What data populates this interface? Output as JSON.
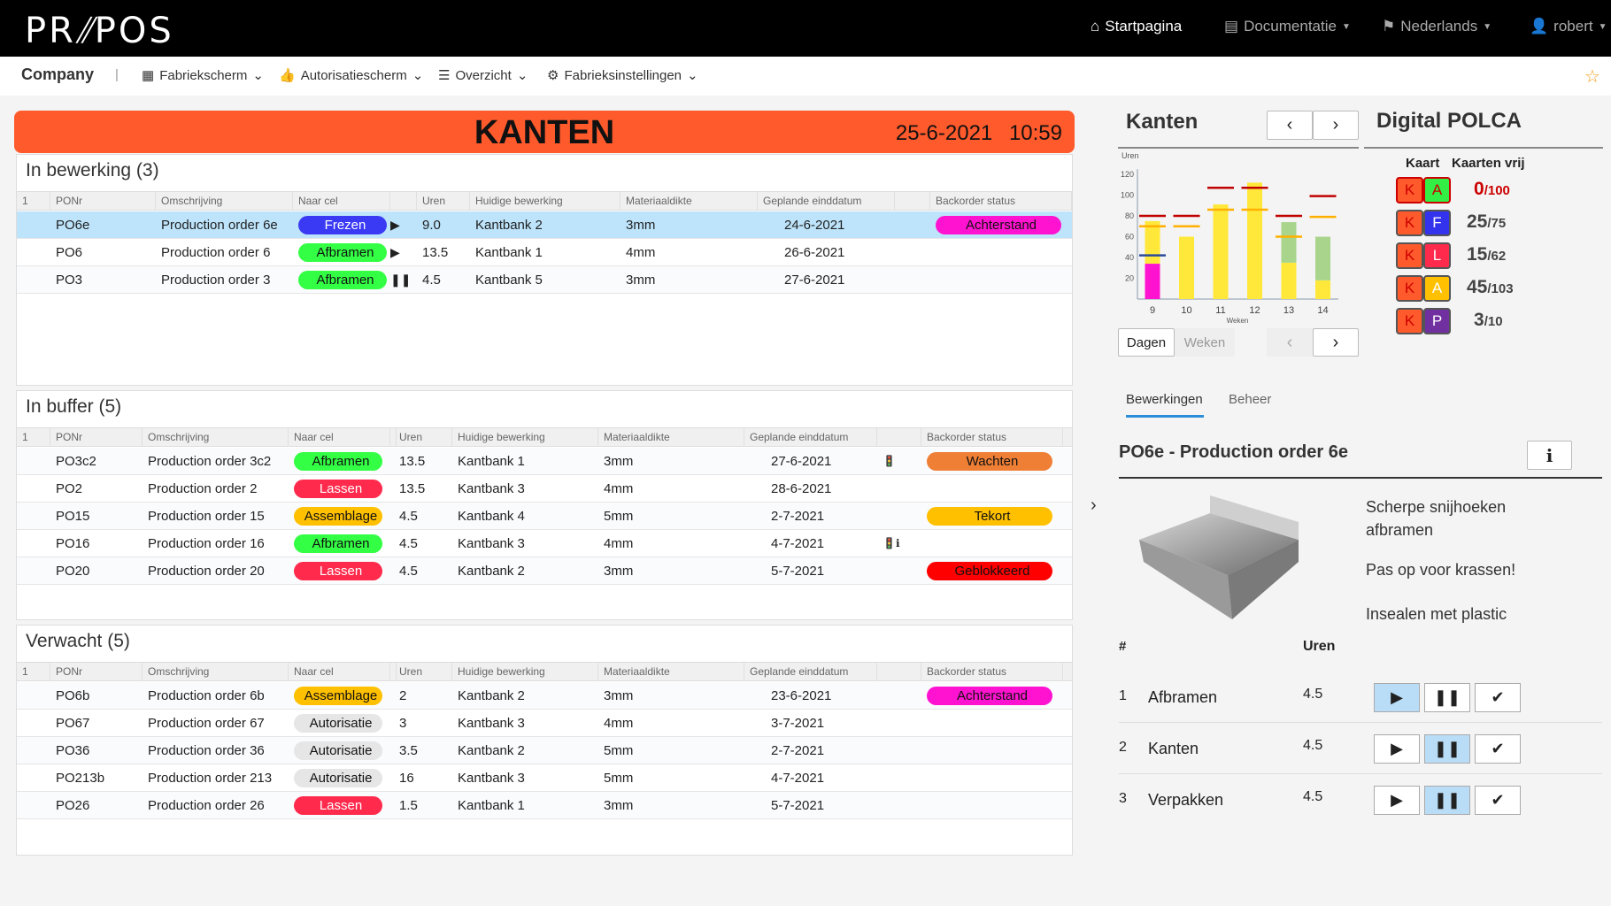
{
  "topbar": {
    "logo": "PR%POS",
    "nav": [
      {
        "label": "Startpagina",
        "icon": "home-icon"
      },
      {
        "label": "Documentatie",
        "icon": "file-icon"
      },
      {
        "label": "Nederlands",
        "icon": "flag-icon"
      },
      {
        "label": "robert",
        "icon": "user-icon"
      }
    ]
  },
  "navbar": {
    "company": "Company",
    "sep": "|",
    "items": [
      {
        "label": "Fabriekscherm",
        "icon": "table-icon"
      },
      {
        "label": "Autorisatiescherm",
        "icon": "thumbs-up-icon"
      },
      {
        "label": "Overzicht",
        "icon": "list-icon"
      },
      {
        "label": "Fabrieksinstellingen",
        "icon": "gear-icon"
      }
    ]
  },
  "banner": {
    "title": "KANTEN",
    "date": "25-6-2021",
    "time": "10:59",
    "color": "#ff5a2c"
  },
  "columns1": [
    "1",
    "PONr",
    "Omschrijving",
    "Naar cel",
    "",
    "Uren",
    "Huidige bewerking",
    "Materiaaldikte",
    "Geplande einddatum",
    "",
    "Backorder status"
  ],
  "sections": [
    {
      "title": "In bewerking (3)",
      "rows": [
        {
          "po": "PO6e",
          "desc": "Production order 6e",
          "cel": "Frezen",
          "celColor": "#3a3af5",
          "celText": "#fff",
          "state": "▶",
          "uren": "9.0",
          "bew": "Kantbank 2",
          "mat": "3mm",
          "date": "24-6-2021",
          "icons": "",
          "status": "Achterstand",
          "statusColor": "#ff12d0",
          "selected": true
        },
        {
          "po": "PO6",
          "desc": "Production order 6",
          "cel": "Afbramen",
          "celColor": "#33ff44",
          "celText": "#111",
          "state": "▶",
          "uren": "13.5",
          "bew": "Kantbank 1",
          "mat": "4mm",
          "date": "26-6-2021",
          "icons": "",
          "status": ""
        },
        {
          "po": "PO3",
          "desc": "Production order 3",
          "cel": "Afbramen",
          "celColor": "#33ff44",
          "celText": "#111",
          "state": "❚❚",
          "uren": "4.5",
          "bew": "Kantbank 5",
          "mat": "3mm",
          "date": "27-6-2021",
          "icons": "",
          "status": ""
        }
      ]
    },
    {
      "title": "In buffer (5)",
      "rows": [
        {
          "po": "PO3c2",
          "desc": "Production order 3c2",
          "cel": "Afbramen",
          "celColor": "#33ff44",
          "celText": "#111",
          "uren": "13.5",
          "bew": "Kantbank 1",
          "mat": "3mm",
          "date": "27-6-2021",
          "icons": "🚦",
          "status": "Wachten",
          "statusColor": "#ef7f35"
        },
        {
          "po": "PO2",
          "desc": "Production order 2",
          "cel": "Lassen",
          "celColor": "#ff2a4c",
          "celText": "#fff",
          "uren": "13.5",
          "bew": "Kantbank 3",
          "mat": "4mm",
          "date": "28-6-2021",
          "icons": "",
          "status": ""
        },
        {
          "po": "PO15",
          "desc": "Production order 15",
          "cel": "Assemblage",
          "celColor": "#ffc000",
          "celText": "#111",
          "uren": "4.5",
          "bew": "Kantbank 4",
          "mat": "5mm",
          "date": "2-7-2021",
          "icons": "",
          "status": "Tekort",
          "statusColor": "#ffc000"
        },
        {
          "po": "PO16",
          "desc": "Production order 16",
          "cel": "Afbramen",
          "celColor": "#33ff44",
          "celText": "#111",
          "uren": "4.5",
          "bew": "Kantbank 3",
          "mat": "4mm",
          "date": "4-7-2021",
          "icons": "🚦ℹ",
          "status": ""
        },
        {
          "po": "PO20",
          "desc": "Production order 20",
          "cel": "Lassen",
          "celColor": "#ff2a4c",
          "celText": "#fff",
          "uren": "4.5",
          "bew": "Kantbank 2",
          "mat": "3mm",
          "date": "5-7-2021",
          "icons": "",
          "status": "Geblokkeerd",
          "statusColor": "#ff0000"
        }
      ]
    },
    {
      "title": "Verwacht (5)",
      "rows": [
        {
          "po": "PO6b",
          "desc": "Production order 6b",
          "cel": "Assemblage",
          "celColor": "#ffc000",
          "celText": "#111",
          "uren": "2",
          "bew": "Kantbank 2",
          "mat": "3mm",
          "date": "23-6-2021",
          "icons": "",
          "status": "Achterstand",
          "statusColor": "#ff12d0"
        },
        {
          "po": "PO67",
          "desc": "Production order 67",
          "cel": "Autorisatie",
          "celColor": "#e6e6e6",
          "celText": "#111",
          "uren": "3",
          "bew": "Kantbank 3",
          "mat": "4mm",
          "date": "3-7-2021",
          "icons": "",
          "status": ""
        },
        {
          "po": "PO36",
          "desc": "Production order 36",
          "cel": "Autorisatie",
          "celColor": "#e6e6e6",
          "celText": "#111",
          "uren": "3.5",
          "bew": "Kantbank 2",
          "mat": "5mm",
          "date": "2-7-2021",
          "icons": "",
          "status": ""
        },
        {
          "po": "PO213b",
          "desc": "Production order 213",
          "cel": "Autorisatie",
          "celColor": "#e6e6e6",
          "celText": "#111",
          "uren": "16",
          "bew": "Kantbank 3",
          "mat": "5mm",
          "date": "4-7-2021",
          "icons": "",
          "status": ""
        },
        {
          "po": "PO26",
          "desc": "Production order 26",
          "cel": "Lassen",
          "celColor": "#ff2a4c",
          "celText": "#fff",
          "uren": "1.5",
          "bew": "Kantbank 1",
          "mat": "3mm",
          "date": "5-7-2021",
          "icons": "",
          "status": ""
        }
      ]
    }
  ],
  "kanten": {
    "title": "Kanten",
    "dagen": "Dagen",
    "weken": "Weken"
  },
  "chart_data": {
    "type": "bar",
    "stacked": true,
    "ylabel": "Uren",
    "xlabel": "Weken",
    "ylim": [
      0,
      120
    ],
    "yticks": [
      20,
      40,
      60,
      80,
      100,
      120
    ],
    "categories": [
      "9",
      "10",
      "11",
      "12",
      "13",
      "14"
    ],
    "series": [
      {
        "color": "#ff12d0",
        "values": [
          34,
          0,
          0,
          0,
          0,
          0
        ]
      },
      {
        "color": "#ffe83a",
        "values": [
          41,
          60,
          91,
          112,
          35,
          18
        ]
      },
      {
        "color": "#a8d48c",
        "values": [
          0,
          0,
          0,
          0,
          39,
          42
        ]
      }
    ],
    "lines": [
      {
        "color": "#c00000",
        "values": [
          80,
          80,
          107,
          107,
          80,
          99
        ]
      },
      {
        "color": "#ffb000",
        "values": [
          70,
          70,
          86,
          86,
          60,
          79
        ]
      },
      {
        "color": "#2a4a9a",
        "values": [
          42,
          null,
          null,
          null,
          null,
          null
        ]
      }
    ]
  },
  "polca": {
    "title": "Digital POLCA",
    "col1": "Kaart",
    "col2": "Kaarten vrij",
    "rows": [
      {
        "k": "K",
        "card": "A",
        "color": "#33ee44",
        "textColor": "#c00",
        "free": "0",
        "total": "/100",
        "alert": true
      },
      {
        "k": "K",
        "card": "F",
        "color": "#3333ee",
        "free": "25",
        "total": "/75"
      },
      {
        "k": "K",
        "card": "L",
        "color": "#ff2a4c",
        "free": "15",
        "total": "/62"
      },
      {
        "k": "K",
        "card": "A",
        "color": "#ffc000",
        "free": "45",
        "total": "/103"
      },
      {
        "k": "K",
        "card": "P",
        "color": "#7030a0",
        "free": "3",
        "total": "/10"
      }
    ]
  },
  "tabs": [
    "Bewerkingen",
    "Beheer"
  ],
  "detail": {
    "title": "PO6e - Production order 6e",
    "notes": [
      "Scherpe snijhoeken afbramen",
      "Pas op voor krassen!",
      "Insealen met plastic"
    ],
    "col_num": "#",
    "col_uren": "Uren",
    "ops": [
      {
        "n": "1",
        "name": "Afbramen",
        "uren": "4.5",
        "active": "play"
      },
      {
        "n": "2",
        "name": "Kanten",
        "uren": "4.5",
        "active": "pause"
      },
      {
        "n": "3",
        "name": "Verpakken",
        "uren": "4.5",
        "active": "pause"
      }
    ]
  }
}
